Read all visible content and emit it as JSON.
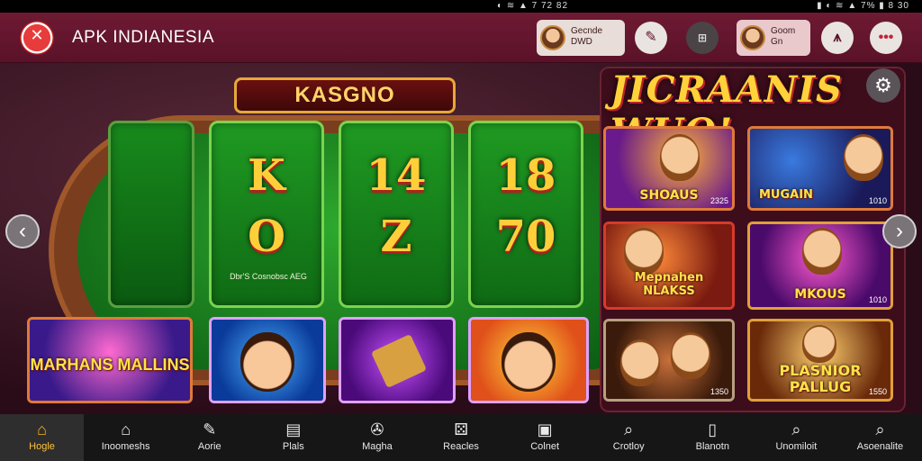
{
  "status_bar": {
    "left": "◐ ≋ ▲ 7 72 82",
    "right": "▮ ◐ ≋ ▲ 7% ▮ 8 30"
  },
  "header": {
    "title": "APK INDIANESIA",
    "profile_left": {
      "line1": "Gecnde",
      "line2": "DWD"
    },
    "profile_right": {
      "line1": "Goom",
      "line2": "Gn"
    },
    "buttons": [
      {
        "icon": "pen-icon",
        "glyph": "✎"
      },
      {
        "icon": "grid-icon",
        "glyph": "⊞"
      },
      {
        "icon": "bank-icon",
        "glyph": "⩚"
      },
      {
        "icon": "dots-icon",
        "glyph": "•••"
      }
    ]
  },
  "main": {
    "banner": "KASGNO",
    "panels": [
      {
        "top": "K",
        "bottom": "O"
      },
      {
        "top": "14",
        "bottom": "Z"
      },
      {
        "top": "18",
        "bottom": "70"
      }
    ],
    "panel_caption": "Dbr'S Cosnobsc AEG",
    "left_tiles": [
      {
        "label": "MARHANS MALLINS"
      },
      {
        "label": ""
      },
      {
        "label": ""
      },
      {
        "label": ""
      }
    ],
    "right_title": "JICRAANIS WUO!",
    "cards": [
      {
        "label": "SHOAUS",
        "num": "2325"
      },
      {
        "label": "MUGAIN",
        "num": "1010"
      },
      {
        "label": "Mepnahen NLAKSS",
        "num": ""
      },
      {
        "label": "MKOUS",
        "num": "1010"
      },
      {
        "label": "",
        "num": "1350"
      },
      {
        "label": "PLASNIOR PALLUG",
        "num": "1550"
      }
    ]
  },
  "bottom_nav": [
    {
      "label": "Hogle",
      "icon": "home-icon",
      "glyph": "⌂",
      "active": true
    },
    {
      "label": "Inoomeshs",
      "icon": "home-outline-icon",
      "glyph": "⌂",
      "active": false
    },
    {
      "label": "Aorie",
      "icon": "pencil-icon",
      "glyph": "✎",
      "active": false
    },
    {
      "label": "Plals",
      "icon": "document-icon",
      "glyph": "▤",
      "active": false
    },
    {
      "label": "Magha",
      "icon": "card-icon",
      "glyph": "✇",
      "active": false
    },
    {
      "label": "Reacles",
      "icon": "puzzle-icon",
      "glyph": "⚄",
      "active": false
    },
    {
      "label": "Colnet",
      "icon": "wallet-icon",
      "glyph": "▣",
      "active": false
    },
    {
      "label": "Crotloy",
      "icon": "search-icon",
      "glyph": "⌕",
      "active": false
    },
    {
      "label": "Blanotn",
      "icon": "info-icon",
      "glyph": "▯",
      "active": false
    },
    {
      "label": "Unomiloit",
      "icon": "search-icon",
      "glyph": "⌕",
      "active": false
    },
    {
      "label": "Asoenalite",
      "icon": "search-icon",
      "glyph": "⌕",
      "active": false
    }
  ],
  "colors": {
    "header": "#6e1a33",
    "felt": "#1f9a22",
    "accent": "#ffc23a",
    "nav_bg": "#161616"
  }
}
